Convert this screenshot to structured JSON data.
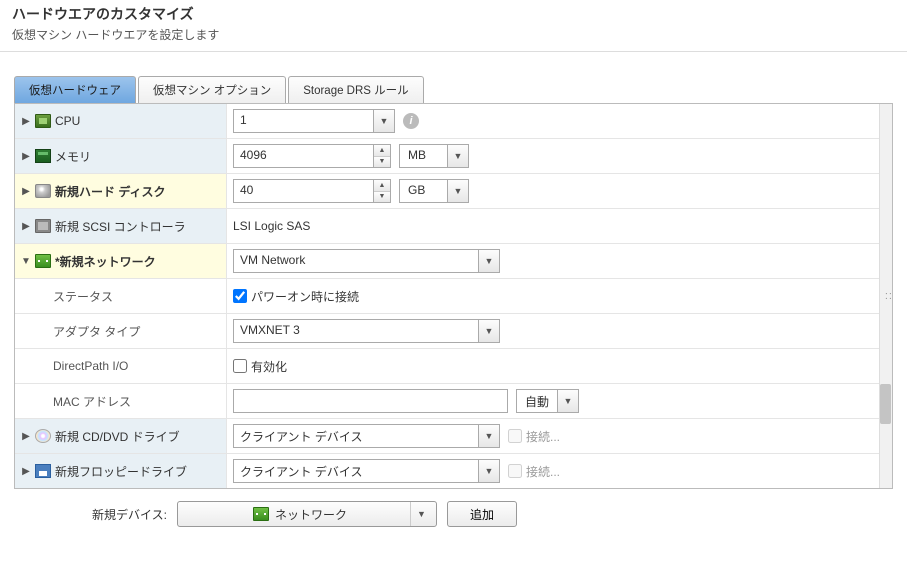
{
  "header": {
    "title": "ハードウエアのカスタマイズ",
    "subtitle": "仮想マシン ハードウエアを設定します"
  },
  "tabs": {
    "virtual_hw": "仮想ハードウェア",
    "vm_options": "仮想マシン オプション",
    "storage_drs": "Storage DRS ルール"
  },
  "rows": {
    "cpu": {
      "label": "CPU",
      "value": "1"
    },
    "memory": {
      "label": "メモリ",
      "value": "4096",
      "unit": "MB"
    },
    "disk": {
      "label": "新規ハード ディスク",
      "value": "40",
      "unit": "GB"
    },
    "scsi": {
      "label": "新規 SCSI コントローラ",
      "value": "LSI Logic SAS"
    },
    "network": {
      "label": "*新規ネットワーク",
      "value": "VM Network"
    },
    "status": {
      "label": "ステータス",
      "checkbox_label": "パワーオン時に接続",
      "checked": true
    },
    "adapter": {
      "label": "アダプタ タイプ",
      "value": "VMXNET 3"
    },
    "directpath": {
      "label": "DirectPath I/O",
      "checkbox_label": "有効化",
      "checked": false
    },
    "mac": {
      "label": "MAC アドレス",
      "value": "",
      "mode": "自動"
    },
    "cddvd": {
      "label": "新規 CD/DVD ドライブ",
      "value": "クライアント デバイス",
      "connect_label": "接続..."
    },
    "floppy": {
      "label": "新規フロッピードライブ",
      "value": "クライアント デバイス",
      "connect_label": "接続..."
    }
  },
  "footer": {
    "label": "新規デバイス:",
    "selected": "ネットワーク",
    "add_button": "追加"
  }
}
